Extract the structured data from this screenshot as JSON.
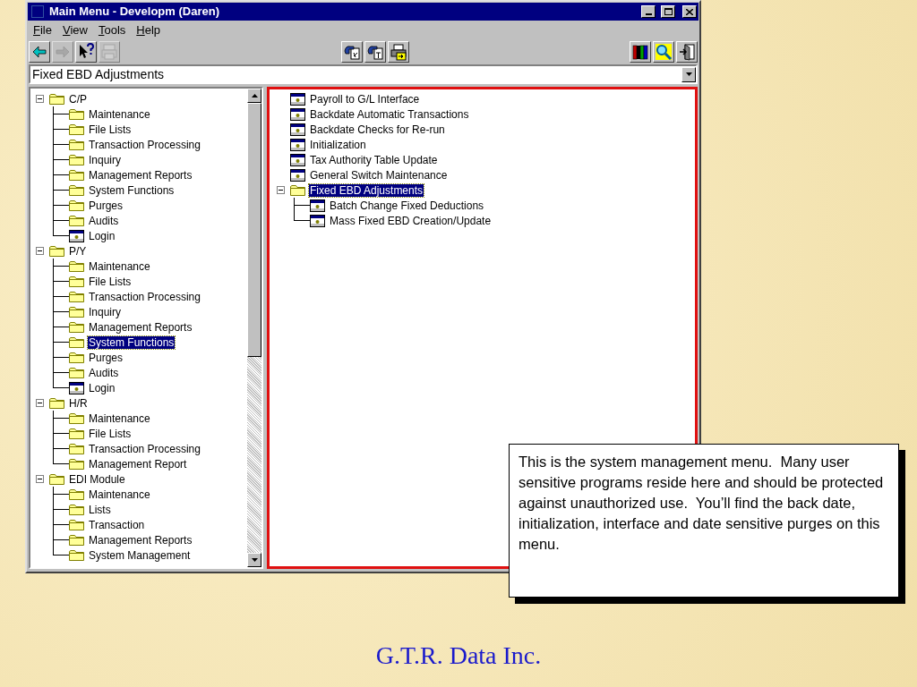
{
  "window": {
    "title": "Main Menu - Developm (Daren)"
  },
  "menu": [
    "File",
    "View",
    "Tools",
    "Help"
  ],
  "toolbar": [
    {
      "kind": "back",
      "disabled": false
    },
    {
      "kind": "forward",
      "disabled": true
    },
    {
      "kind": "help",
      "disabled": false
    },
    {
      "kind": "print",
      "disabled": true
    },
    {
      "kind": "gap"
    },
    {
      "kind": "hand-r",
      "disabled": false
    },
    {
      "kind": "hand-t",
      "disabled": false
    },
    {
      "kind": "printer-arrow",
      "disabled": false
    },
    {
      "kind": "gap"
    },
    {
      "kind": "books",
      "disabled": false
    },
    {
      "kind": "search",
      "disabled": false
    },
    {
      "kind": "exit",
      "disabled": false
    }
  ],
  "location": {
    "value": "Fixed EBD Adjustments"
  },
  "left_tree": [
    {
      "label": "C/P",
      "kind": "folder",
      "expanded": true,
      "selected": false,
      "children": [
        {
          "label": "Maintenance",
          "kind": "folder",
          "selected": false
        },
        {
          "label": "File Lists",
          "kind": "folder",
          "selected": false
        },
        {
          "label": "Transaction Processing",
          "kind": "folder",
          "selected": false
        },
        {
          "label": "Inquiry",
          "kind": "folder",
          "selected": false
        },
        {
          "label": "Management Reports",
          "kind": "folder",
          "selected": false
        },
        {
          "label": "System Functions",
          "kind": "folder",
          "selected": false
        },
        {
          "label": "Purges",
          "kind": "folder",
          "selected": false
        },
        {
          "label": "Audits",
          "kind": "folder",
          "selected": false
        },
        {
          "label": "Login",
          "kind": "program",
          "selected": false
        }
      ]
    },
    {
      "label": "P/Y",
      "kind": "folder",
      "expanded": true,
      "selected": false,
      "children": [
        {
          "label": "Maintenance",
          "kind": "folder",
          "selected": false
        },
        {
          "label": "File Lists",
          "kind": "folder",
          "selected": false
        },
        {
          "label": "Transaction Processing",
          "kind": "folder",
          "selected": false
        },
        {
          "label": "Inquiry",
          "kind": "folder",
          "selected": false
        },
        {
          "label": "Management Reports",
          "kind": "folder",
          "selected": false
        },
        {
          "label": "System Functions",
          "kind": "folder",
          "selected": true
        },
        {
          "label": "Purges",
          "kind": "folder",
          "selected": false
        },
        {
          "label": "Audits",
          "kind": "folder",
          "selected": false
        },
        {
          "label": "Login",
          "kind": "program",
          "selected": false
        }
      ]
    },
    {
      "label": "H/R",
      "kind": "folder",
      "expanded": true,
      "selected": false,
      "children": [
        {
          "label": "Maintenance",
          "kind": "folder",
          "selected": false
        },
        {
          "label": "File Lists",
          "kind": "folder",
          "selected": false
        },
        {
          "label": "Transaction Processing",
          "kind": "folder",
          "selected": false
        },
        {
          "label": "Management Report",
          "kind": "folder",
          "selected": false
        }
      ]
    },
    {
      "label": "EDI Module",
      "kind": "folder",
      "expanded": true,
      "selected": false,
      "children": [
        {
          "label": "Maintenance",
          "kind": "folder",
          "selected": false
        },
        {
          "label": "Lists",
          "kind": "folder",
          "selected": false
        },
        {
          "label": "Transaction",
          "kind": "folder",
          "selected": false
        },
        {
          "label": "Management Reports",
          "kind": "folder",
          "selected": false
        },
        {
          "label": "System Management",
          "kind": "folder",
          "selected": false
        }
      ]
    }
  ],
  "right_tree": [
    {
      "label": "Payroll to G/L Interface",
      "kind": "program",
      "selected": false
    },
    {
      "label": "Backdate Automatic Transactions",
      "kind": "program",
      "selected": false
    },
    {
      "label": "Backdate Checks for Re-run",
      "kind": "program",
      "selected": false
    },
    {
      "label": "Initialization",
      "kind": "program",
      "selected": false
    },
    {
      "label": "Tax Authority Table Update",
      "kind": "program",
      "selected": false
    },
    {
      "label": "General Switch Maintenance",
      "kind": "program",
      "selected": false
    },
    {
      "label": "Fixed EBD Adjustments",
      "kind": "folder",
      "expanded": true,
      "selected": true,
      "children": [
        {
          "label": "Batch Change Fixed Deductions",
          "kind": "program",
          "selected": false
        },
        {
          "label": "Mass Fixed EBD Creation/Update",
          "kind": "program",
          "selected": false
        }
      ]
    }
  ],
  "callout": "This is the system management menu.  Many user sensitive programs reside here and should be protected against unauthorized use.  You’ll find the back date, initialization, interface and date sensitive purges on this menu.",
  "footer": "G.T.R. Data Inc."
}
